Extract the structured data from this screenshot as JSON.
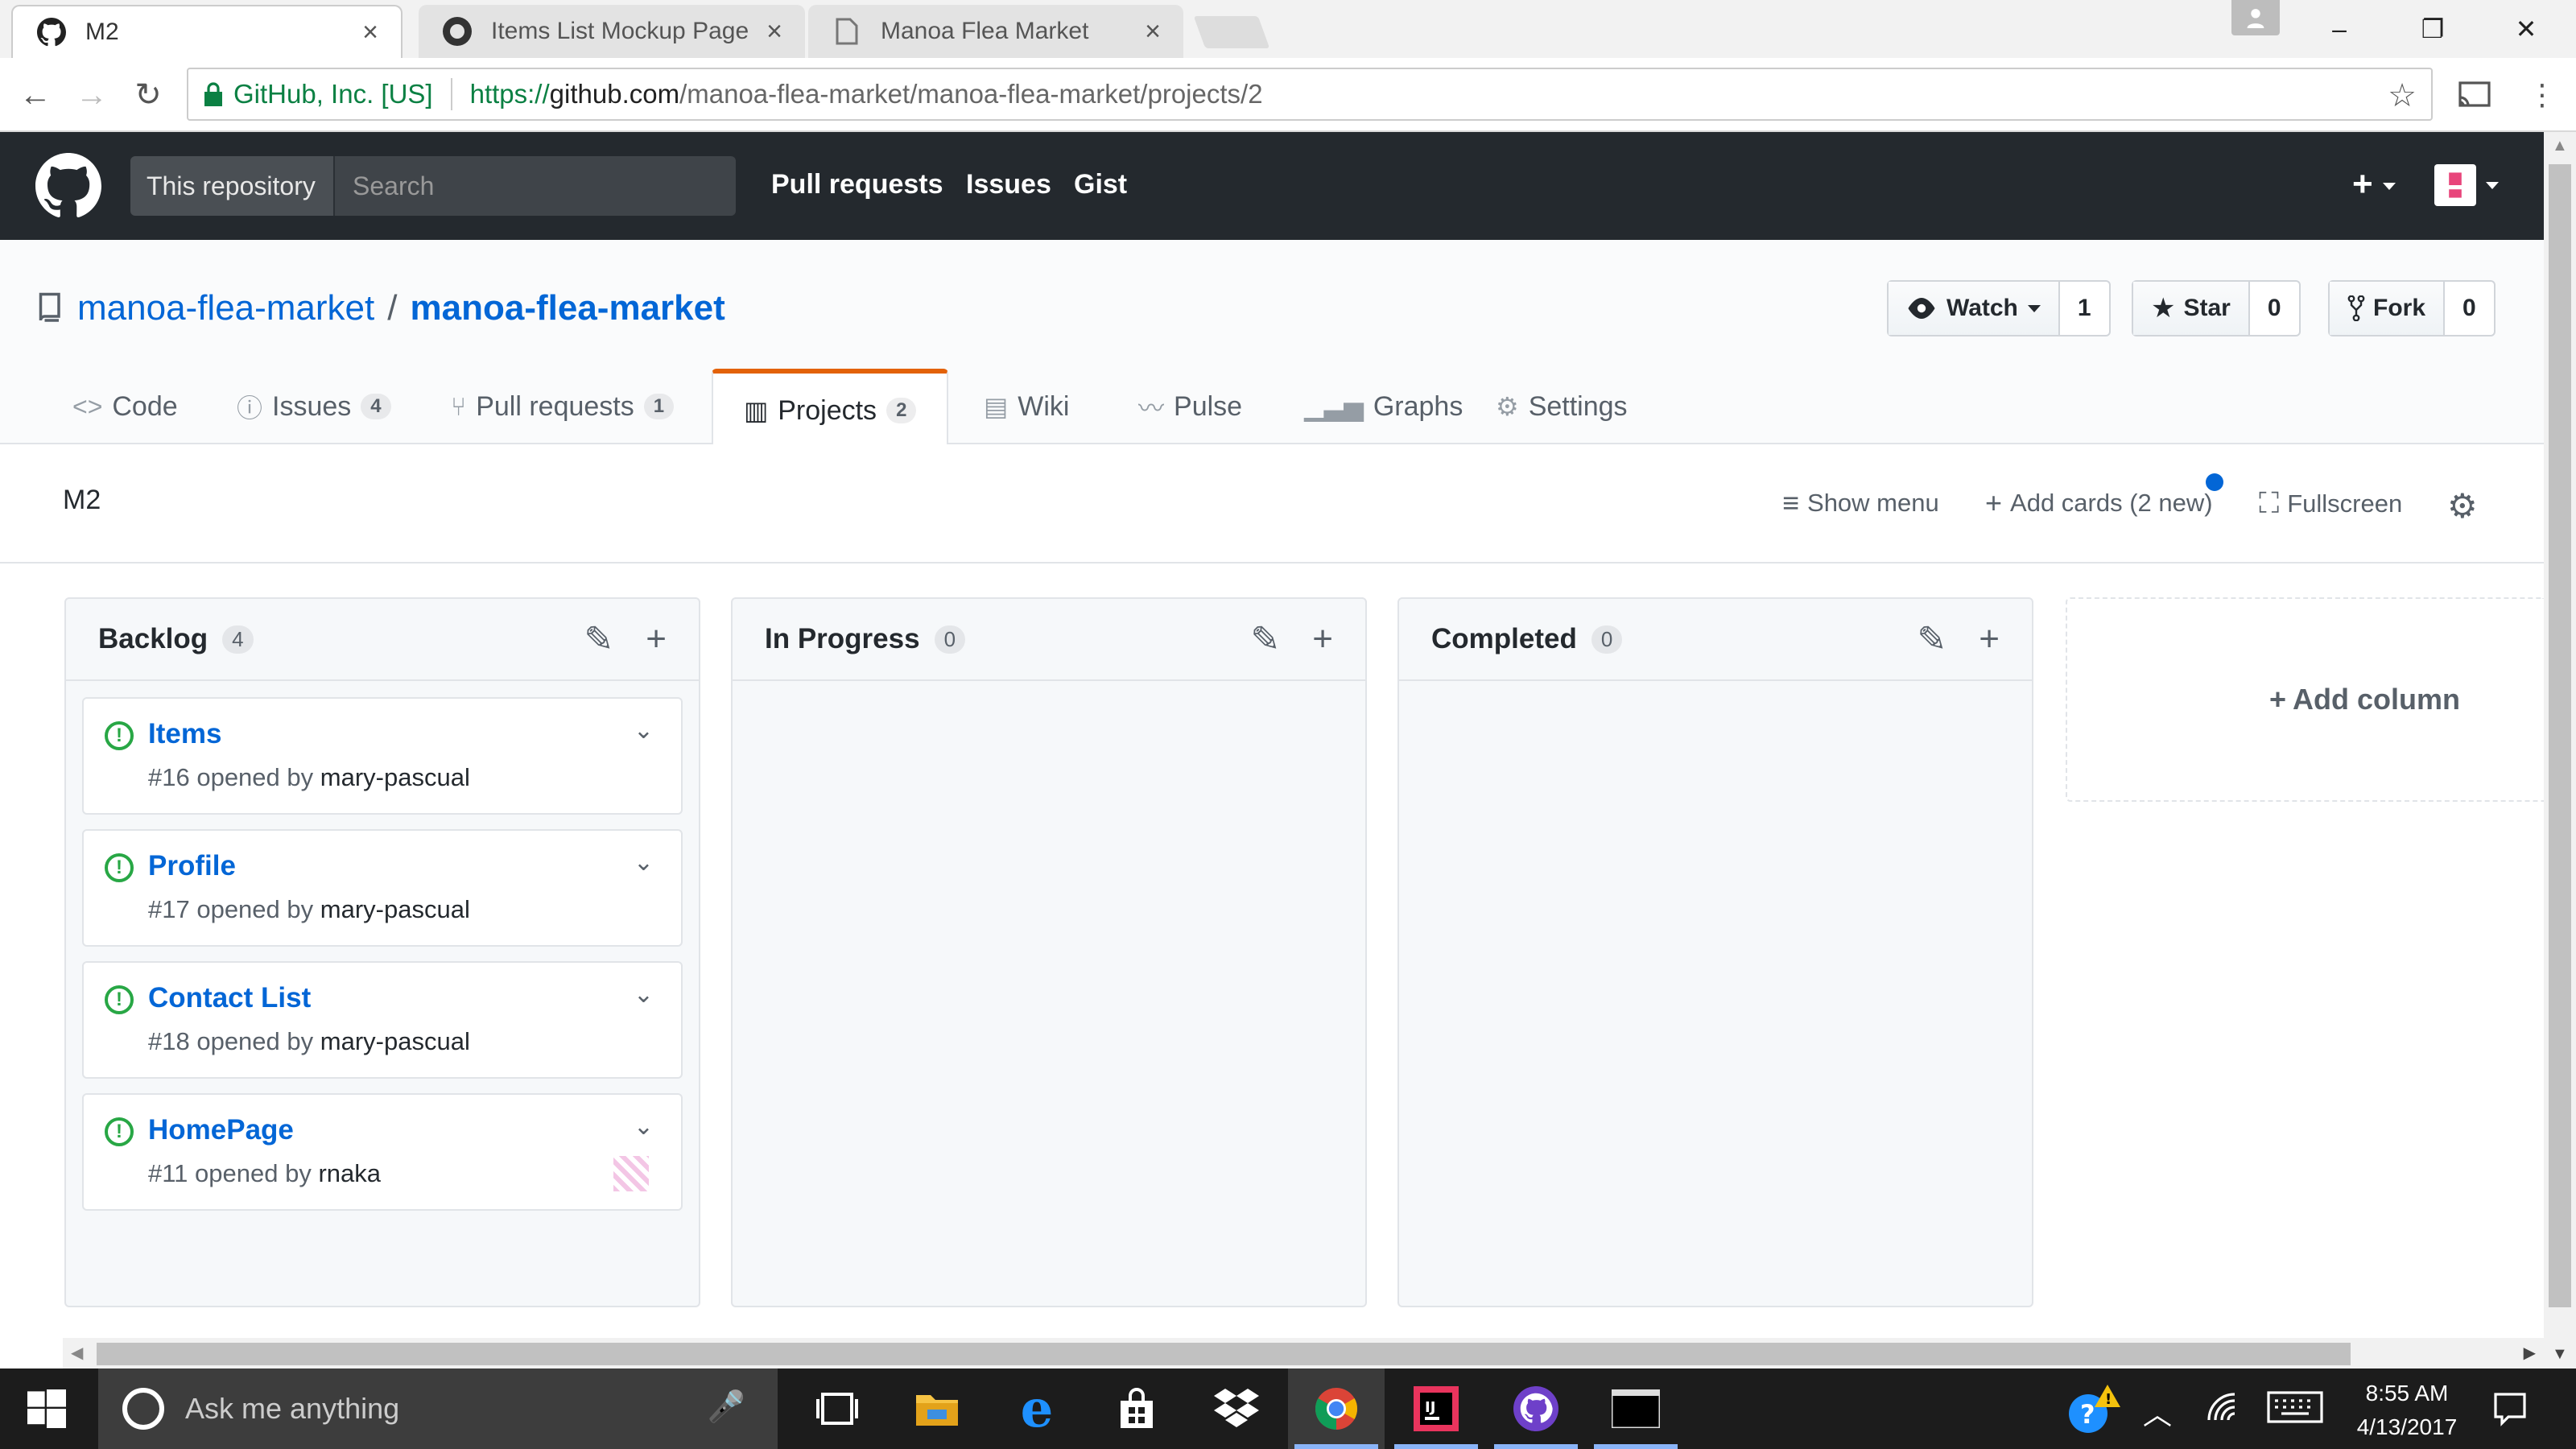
{
  "browser": {
    "tabs": [
      {
        "title": "M2",
        "active": true
      },
      {
        "title": "Items List Mockup Page",
        "active": false
      },
      {
        "title": "Manoa Flea Market",
        "active": false
      }
    ],
    "close_glyph": "×",
    "window": {
      "minimize": "–",
      "maximize": "❐",
      "close": "✕"
    },
    "address": {
      "security_label": "GitHub, Inc. [US]",
      "scheme": "https://",
      "host": "github.com",
      "path": "/manoa-flea-market/manoa-flea-market/projects/2"
    }
  },
  "github_header": {
    "scope_label": "This repository",
    "search_placeholder": "Search",
    "nav": [
      "Pull requests",
      "Issues",
      "Gist"
    ],
    "plus": "+"
  },
  "repo": {
    "owner": "manoa-flea-market",
    "separator": "/",
    "name": "manoa-flea-market",
    "watch": {
      "label": "Watch",
      "count": "1"
    },
    "star": {
      "label": "Star",
      "count": "0"
    },
    "fork": {
      "label": "Fork",
      "count": "0"
    },
    "tabs": [
      {
        "label": "Code",
        "icon": "code-icon",
        "glyph": "<>",
        "counter": ""
      },
      {
        "label": "Issues",
        "icon": "issue-icon",
        "glyph": "ⓘ",
        "counter": "4"
      },
      {
        "label": "Pull requests",
        "icon": "pull-request-icon",
        "glyph": "⑂",
        "counter": "1"
      },
      {
        "label": "Projects",
        "icon": "project-icon",
        "glyph": "▥",
        "counter": "2",
        "selected": true
      },
      {
        "label": "Wiki",
        "icon": "book-icon",
        "glyph": "▤",
        "counter": ""
      },
      {
        "label": "Pulse",
        "icon": "pulse-icon",
        "glyph": "〰",
        "counter": ""
      },
      {
        "label": "Graphs",
        "icon": "graph-icon",
        "glyph": "▁▃▅",
        "counter": ""
      },
      {
        "label": "Settings",
        "icon": "gear-icon",
        "glyph": "⚙",
        "counter": ""
      }
    ]
  },
  "project": {
    "name": "M2",
    "show_menu": "Show menu",
    "add_cards": "Add cards (2 new)",
    "fullscreen": "Fullscreen",
    "columns": [
      {
        "title": "Backlog",
        "count": "4",
        "cards": [
          {
            "title": "Items",
            "meta_prefix": "#16 opened by",
            "author": "mary-pascual",
            "has_avatar": false
          },
          {
            "title": "Profile",
            "meta_prefix": "#17 opened by",
            "author": "mary-pascual",
            "has_avatar": false
          },
          {
            "title": "Contact List",
            "meta_prefix": "#18 opened by",
            "author": "mary-pascual",
            "has_avatar": false
          },
          {
            "title": "HomePage",
            "meta_prefix": "#11 opened by",
            "author": "rnaka",
            "has_avatar": true
          }
        ]
      },
      {
        "title": "In Progress",
        "count": "0",
        "cards": []
      },
      {
        "title": "Completed",
        "count": "0",
        "cards": []
      }
    ],
    "add_column": "Add column"
  },
  "taskbar": {
    "search_placeholder": "Ask me anything",
    "time": "8:55 AM",
    "date": "4/13/2017",
    "apps": [
      "task-view-icon",
      "file-explorer-icon",
      "edge-icon",
      "store-icon",
      "dropbox-icon",
      "chrome-icon",
      "intellij-icon",
      "github-desktop-icon",
      "terminal-icon"
    ]
  },
  "colors": {
    "github_header": "#24292e",
    "link": "#0366d6",
    "issue_open": "#28a745",
    "selected_tab_accent": "#e36209"
  }
}
